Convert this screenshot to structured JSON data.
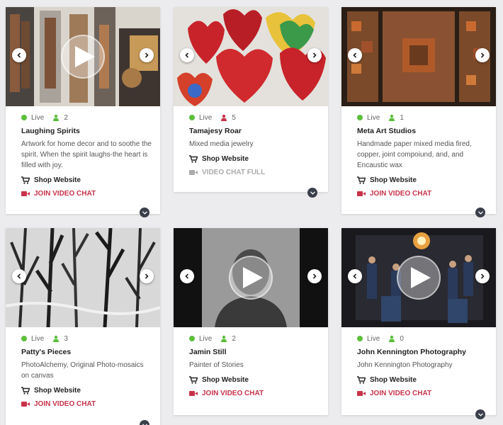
{
  "colors": {
    "live": "#5bbf3a",
    "person_live": "#5bbf3a",
    "person_full": "#c8334a",
    "join": "#c8334a",
    "full": "#aaaaaa"
  },
  "icons": {
    "arrow_left": "chevron-left-icon",
    "arrow_right": "chevron-right-icon",
    "play": "play-icon",
    "cart": "cart-icon",
    "video": "video-camera-icon",
    "person": "person-icon",
    "expand": "chevron-down-icon"
  },
  "cards": [
    {
      "live": "Live",
      "count": "2",
      "title": "Laughing Spirits",
      "desc": "Artwork for home decor and to soothe the spirit. When the spirit laughs-the heart is filled with joy.",
      "shop": "Shop Website",
      "chat": "JOIN VIDEO CHAT",
      "chat_state": "join",
      "has_play": true
    },
    {
      "live": "Live",
      "count": "5",
      "title": "Tamajesy Roar",
      "desc": "Mixed media jewelry",
      "shop": "Shop Website",
      "chat": "VIDEO CHAT FULL",
      "chat_state": "full",
      "has_play": false
    },
    {
      "live": "Live",
      "count": "1",
      "title": "Meta Art Studios",
      "desc": "Handmade paper mixed media fired, copper, joint compoiund, and, and Encaustic wax",
      "shop": "Shop Website",
      "chat": "JOIN VIDEO CHAT",
      "chat_state": "join",
      "has_play": false
    },
    {
      "live": "Live",
      "count": "3",
      "title": "Patty's Pieces",
      "desc": "PhotoAlchemy, Original Photo-mosaics on canvas",
      "shop": "Shop Website",
      "chat": "JOIN VIDEO CHAT",
      "chat_state": "join",
      "has_play": false
    },
    {
      "live": "Live",
      "count": "2",
      "title": "Jamin Still",
      "desc": "Painter of Stories",
      "shop": "Shop Website",
      "chat": "JOIN VIDEO CHAT",
      "chat_state": "join",
      "has_play": true
    },
    {
      "live": "Live",
      "count": "0",
      "title": "John Kennington Photography",
      "desc": "John Kennington Photography",
      "shop": "Shop Website",
      "chat": "JOIN VIDEO CHAT",
      "chat_state": "join",
      "has_play": true
    }
  ]
}
